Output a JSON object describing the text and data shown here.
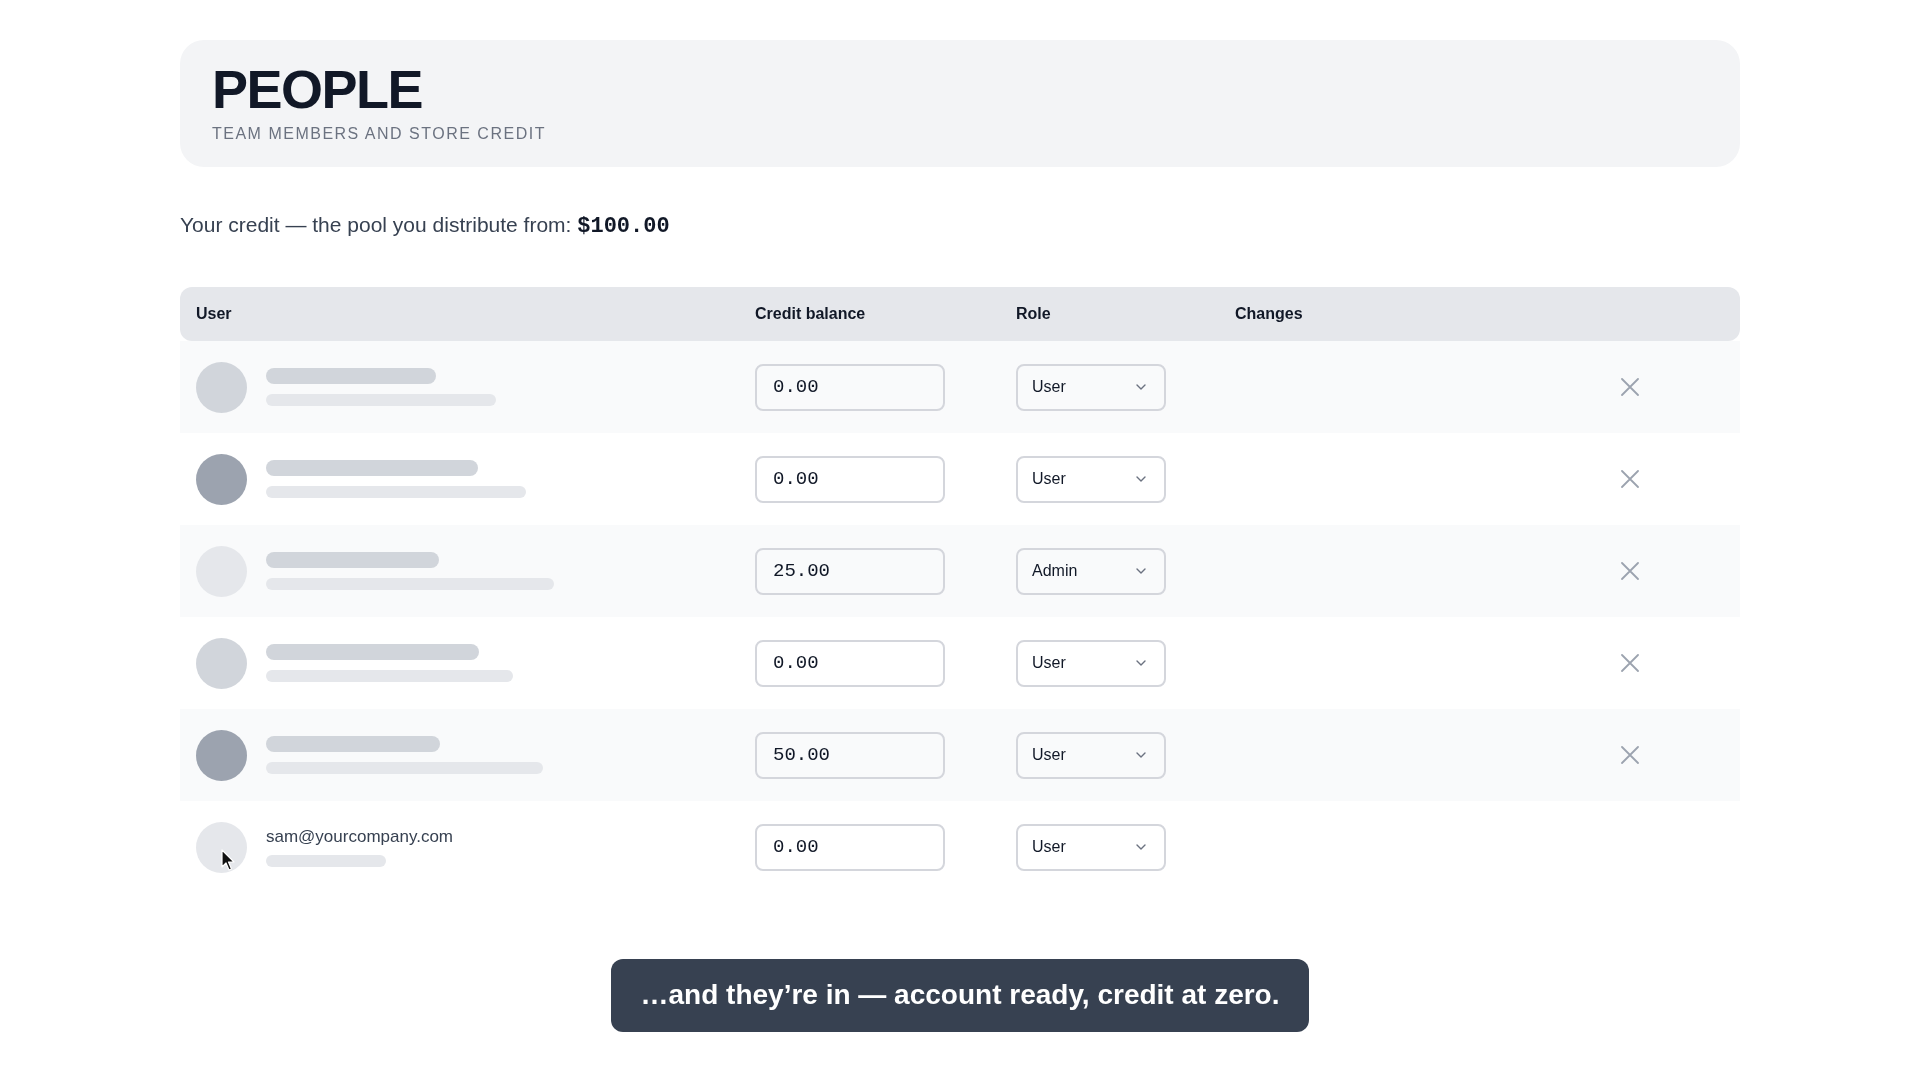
{
  "header": {
    "title": "PEOPLE",
    "subtitle": "TEAM MEMBERS AND STORE CREDIT"
  },
  "credit_line": "Your credit — the pool you distribute from: **$100.00**",
  "table": {
    "columns": [
      "User",
      "Credit balance",
      "Role",
      "Changes"
    ],
    "rows": [
      {
        "kind": "skeleton",
        "credit": "0.00",
        "role": "User",
        "removable": true,
        "hovered": false
      },
      {
        "kind": "skeleton",
        "credit": "0.00",
        "role": "User",
        "removable": true,
        "hovered": false
      },
      {
        "kind": "skeleton",
        "credit": "25.00",
        "role": "Admin",
        "removable": true,
        "hovered": false
      },
      {
        "kind": "skeleton",
        "credit": "0.00",
        "role": "User",
        "removable": true,
        "hovered": false
      },
      {
        "kind": "skeleton",
        "credit": "50.00",
        "role": "User",
        "removable": true,
        "hovered": false
      },
      {
        "kind": "invited",
        "email": "sam@yourcompany.com",
        "credit": "0.00",
        "role": "User",
        "removable": false,
        "hovered": true
      }
    ]
  },
  "caption": "…and they’re in — account ready, credit at zero."
}
